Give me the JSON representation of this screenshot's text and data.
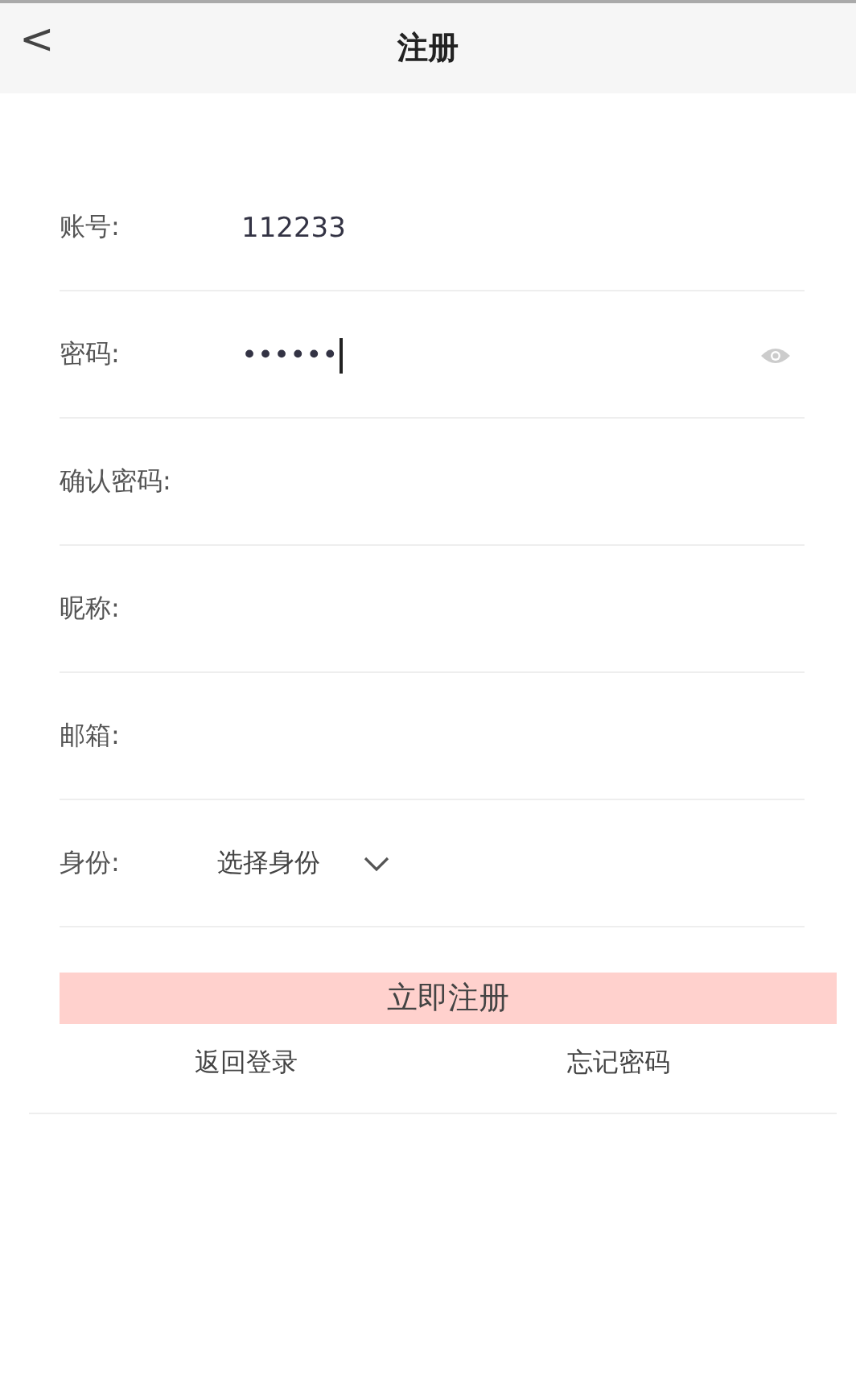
{
  "header": {
    "back": "<",
    "title": "注册"
  },
  "fields": [
    {
      "kind": "text",
      "label": "账号:",
      "value": "112233",
      "focused": false
    },
    {
      "kind": "password",
      "label": "密码:",
      "value": "••••••",
      "focused": true
    },
    {
      "kind": "text",
      "label": "确认密码:",
      "focused": false
    },
    {
      "kind": "text",
      "label": "昵称:",
      "focused": false
    },
    {
      "kind": "text",
      "label": "邮箱:",
      "focused": false
    },
    {
      "kind": "select",
      "label": "身份:",
      "value": "选择身份",
      "focused": false
    }
  ],
  "submit": "立即注册",
  "links": [
    "返回登录",
    "忘记密码"
  ]
}
